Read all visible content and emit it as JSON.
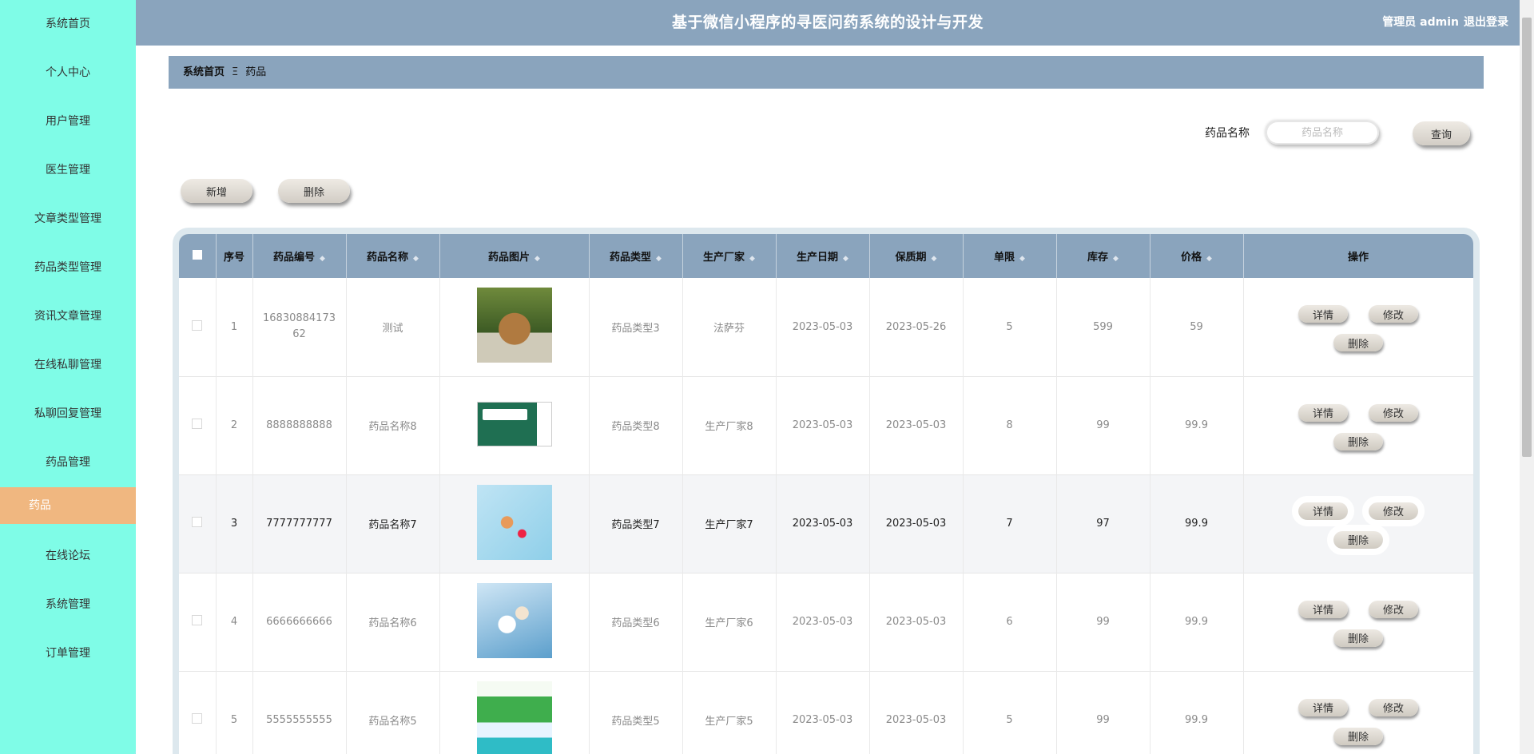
{
  "app": {
    "title": "基于微信小程序的寻医问药系统的设计与开发",
    "user_label": "管理员 admin",
    "logout_label": "退出登录"
  },
  "sidebar": {
    "items": [
      {
        "label": "系统首页"
      },
      {
        "label": "个人中心"
      },
      {
        "label": "用户管理"
      },
      {
        "label": "医生管理"
      },
      {
        "label": "文章类型管理"
      },
      {
        "label": "药品类型管理"
      },
      {
        "label": "资讯文章管理"
      },
      {
        "label": "在线私聊管理"
      },
      {
        "label": "私聊回复管理"
      },
      {
        "label": "药品管理"
      },
      {
        "label": "药品",
        "active": true
      },
      {
        "label": "在线论坛"
      },
      {
        "label": "系统管理"
      },
      {
        "label": "订单管理"
      }
    ]
  },
  "breadcrumb": {
    "home": "系统首页",
    "separator": "Ξ",
    "current": "药品"
  },
  "search": {
    "label": "药品名称",
    "placeholder": "药品名称",
    "query_label": "查询"
  },
  "toolbar": {
    "add_label": "新增",
    "delete_label": "删除"
  },
  "table": {
    "headers": {
      "index": "序号",
      "code": "药品编号",
      "name": "药品名称",
      "image": "药品图片",
      "type": "药品类型",
      "maker": "生产厂家",
      "date": "生产日期",
      "expiry": "保质期",
      "limit": "单限",
      "stock": "库存",
      "price": "价格",
      "ops": "操作"
    },
    "sort_icon": "◆",
    "actions": {
      "detail": "详情",
      "edit": "修改",
      "delete": "删除"
    },
    "rows": [
      {
        "index": "1",
        "code": "1683088417362",
        "name": "测试",
        "image": "rabbit-photo",
        "type": "药品类型3",
        "maker": "法萨芬",
        "date": "2023-05-03",
        "expiry": "2023-05-26",
        "limit": "5",
        "stock": "599",
        "price": "59"
      },
      {
        "index": "2",
        "code": "8888888888",
        "name": "药品名称8",
        "image": "medicine-box",
        "type": "药品类型8",
        "maker": "生产厂家8",
        "date": "2023-05-03",
        "expiry": "2023-05-03",
        "limit": "8",
        "stock": "99",
        "price": "99.9"
      },
      {
        "index": "3",
        "code": "7777777777",
        "name": "药品名称7",
        "image": "capsules-spoon",
        "type": "药品类型7",
        "maker": "生产厂家7",
        "date": "2023-05-03",
        "expiry": "2023-05-03",
        "limit": "7",
        "stock": "97",
        "price": "99.9"
      },
      {
        "index": "4",
        "code": "6666666666",
        "name": "药品名称6",
        "image": "pills-blue",
        "type": "药品类型6",
        "maker": "生产厂家6",
        "date": "2023-05-03",
        "expiry": "2023-05-03",
        "limit": "6",
        "stock": "99",
        "price": "99.9"
      },
      {
        "index": "5",
        "code": "5555555555",
        "name": "药品名称5",
        "image": "green-box",
        "type": "药品类型5",
        "maker": "生产厂家5",
        "date": "2023-05-03",
        "expiry": "2023-05-03",
        "limit": "5",
        "stock": "99",
        "price": "99.9"
      }
    ]
  },
  "colors": {
    "sidebar_bg": "#7ffce7",
    "sidebar_active": "#f0b780",
    "header_bg": "#8aa4bd"
  }
}
